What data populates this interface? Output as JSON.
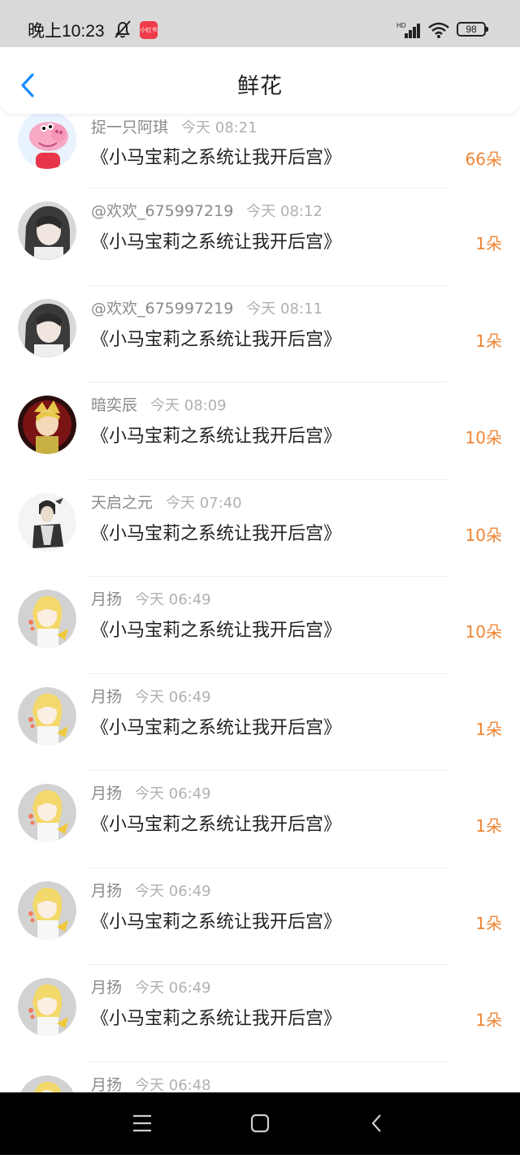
{
  "status": {
    "time": "晚上10:23",
    "app_badge": "小红书",
    "network": "HD",
    "battery": "98"
  },
  "header": {
    "title": "鲜花"
  },
  "colors": {
    "accent": "#1a8cff",
    "flower_count": "#f08533"
  },
  "items": [
    {
      "user": "捉一只阿琪",
      "time": "今天 08:21",
      "book": "《小马宝莉之系统让我开后宫》",
      "count": "66朵",
      "avatar": "pig"
    },
    {
      "user": "@欢欢_675997219",
      "time": "今天 08:12",
      "book": "《小马宝莉之系统让我开后宫》",
      "count": "1朵",
      "avatar": "dark"
    },
    {
      "user": "@欢欢_675997219",
      "time": "今天 08:11",
      "book": "《小马宝莉之系统让我开后宫》",
      "count": "1朵",
      "avatar": "dark"
    },
    {
      "user": "暗奕辰",
      "time": "今天 08:09",
      "book": "《小马宝莉之系统让我开后宫》",
      "count": "10朵",
      "avatar": "red"
    },
    {
      "user": "天启之元",
      "time": "今天 07:40",
      "book": "《小马宝莉之系统让我开后宫》",
      "count": "10朵",
      "avatar": "sketch"
    },
    {
      "user": "月扬",
      "time": "今天 06:49",
      "book": "《小马宝莉之系统让我开后宫》",
      "count": "10朵",
      "avatar": "blonde"
    },
    {
      "user": "月扬",
      "time": "今天 06:49",
      "book": "《小马宝莉之系统让我开后宫》",
      "count": "1朵",
      "avatar": "blonde"
    },
    {
      "user": "月扬",
      "time": "今天 06:49",
      "book": "《小马宝莉之系统让我开后宫》",
      "count": "1朵",
      "avatar": "blonde"
    },
    {
      "user": "月扬",
      "time": "今天 06:49",
      "book": "《小马宝莉之系统让我开后宫》",
      "count": "1朵",
      "avatar": "blonde"
    },
    {
      "user": "月扬",
      "time": "今天 06:49",
      "book": "《小马宝莉之系统让我开后宫》",
      "count": "1朵",
      "avatar": "blonde"
    },
    {
      "user": "月扬",
      "time": "今天 06:48",
      "book": "",
      "count": "",
      "avatar": "blonde"
    }
  ],
  "navbar": {
    "icons": [
      "menu-icon",
      "home-icon",
      "back-icon"
    ]
  }
}
